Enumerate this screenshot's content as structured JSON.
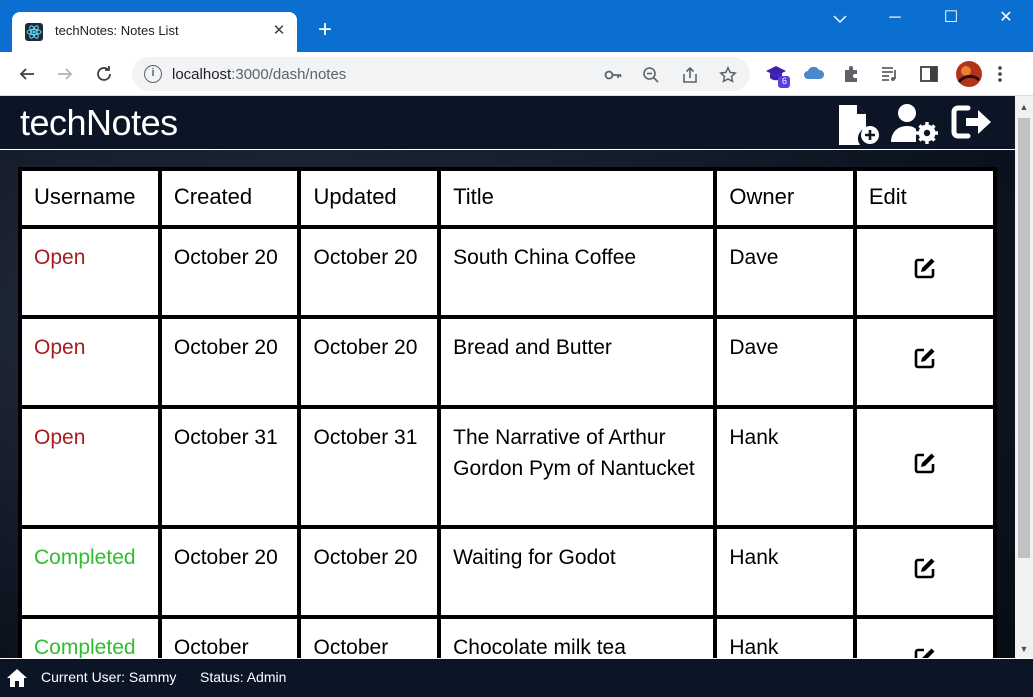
{
  "browser": {
    "tab_title": "techNotes: Notes List",
    "tab_close": "✕",
    "new_tab": "+",
    "window_controls": {
      "minimize": "─",
      "maximize": "☐",
      "close": "✕"
    },
    "url_host": "localhost",
    "url_path": ":3000/dash/notes",
    "info_glyph": "i",
    "extension_badge": "6",
    "colors": {
      "title_bar": "#0a6fd1",
      "toolbar": "#ffffff"
    }
  },
  "app": {
    "brand": "techNotes",
    "colors": {
      "header_bg": "#0c1525",
      "open": "#a51d1d",
      "completed": "#2fbe2f"
    }
  },
  "table": {
    "headers": [
      "Username",
      "Created",
      "Updated",
      "Title",
      "Owner",
      "Edit"
    ],
    "rows": [
      {
        "status": "Open",
        "created": "October 20",
        "updated": "October 20",
        "title": "South China Coffee",
        "owner": "Dave"
      },
      {
        "status": "Open",
        "created": "October 20",
        "updated": "October 20",
        "title": "Bread and Butter",
        "owner": "Dave"
      },
      {
        "status": "Open",
        "created": "October 31",
        "updated": "October 31",
        "title": "The Narrative of Arthur Gordon Pym of Nantucket",
        "owner": "Hank"
      },
      {
        "status": "Completed",
        "created": "October 20",
        "updated": "October 20",
        "title": "Waiting for Godot",
        "owner": "Hank"
      },
      {
        "status": "Completed",
        "created": "October",
        "updated": "October",
        "title": "Chocolate milk tea",
        "owner": "Hank"
      }
    ]
  },
  "footer": {
    "current_user": "Current User: Sammy",
    "status": "Status: Admin"
  }
}
